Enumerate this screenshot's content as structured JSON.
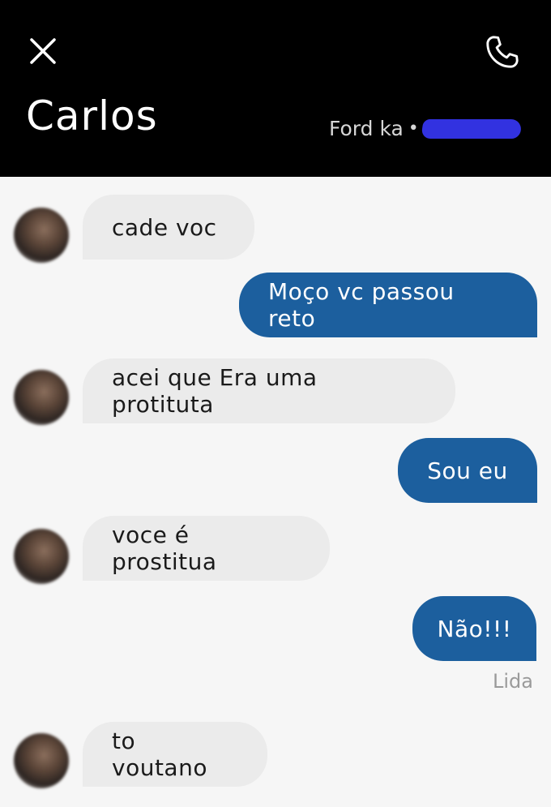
{
  "header": {
    "contact_name": "Carlos",
    "vehicle": "Ford ka",
    "close_icon": "close-icon",
    "phone_icon": "phone-icon"
  },
  "messages": [
    {
      "from": "driver",
      "text": "cade voc"
    },
    {
      "from": "me",
      "text": "Moço vc passou reto"
    },
    {
      "from": "driver",
      "text": "acei que Era uma protituta"
    },
    {
      "from": "me",
      "text": "Sou eu"
    },
    {
      "from": "driver",
      "text": "voce é prostitua"
    },
    {
      "from": "me",
      "text": "Não!!!"
    },
    {
      "from": "driver",
      "text": "to voutano"
    }
  ],
  "read_receipt": "Lida",
  "colors": {
    "header_bg": "#000000",
    "outgoing_bubble": "#1c5f9e",
    "incoming_bubble": "#ebebeb",
    "background": "#f6f6f6",
    "redaction": "#3232e0"
  }
}
